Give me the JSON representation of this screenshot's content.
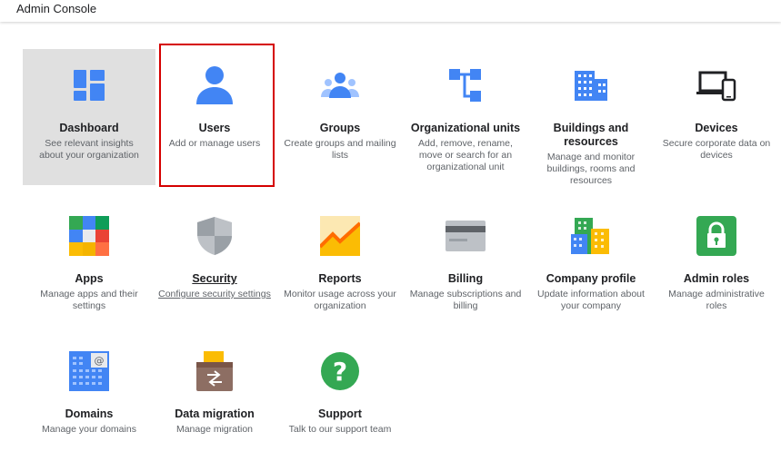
{
  "header": {
    "title": "Admin Console"
  },
  "tiles": [
    {
      "title": "Dashboard",
      "desc": "See relevant insights about your organization",
      "icon": "dashboard-icon"
    },
    {
      "title": "Users",
      "desc": "Add or manage users",
      "icon": "user-icon"
    },
    {
      "title": "Groups",
      "desc": "Create groups and mailing lists",
      "icon": "groups-icon"
    },
    {
      "title": "Organizational units",
      "desc": "Add, remove, rename, move or search for an organizational unit",
      "icon": "org-units-icon"
    },
    {
      "title": "Buildings and resources",
      "desc": "Manage and monitor buildings, rooms and resources",
      "icon": "building-icon"
    },
    {
      "title": "Devices",
      "desc": "Secure corporate data on devices",
      "icon": "devices-icon"
    },
    {
      "title": "Apps",
      "desc": "Manage apps and their settings",
      "icon": "apps-icon"
    },
    {
      "title": "Security",
      "desc": "Configure security settings",
      "icon": "shield-icon"
    },
    {
      "title": "Reports",
      "desc": "Monitor usage across your organization",
      "icon": "reports-icon"
    },
    {
      "title": "Billing",
      "desc": "Manage subscriptions and billing",
      "icon": "credit-card-icon"
    },
    {
      "title": "Company profile",
      "desc": "Update information about your company",
      "icon": "company-icon"
    },
    {
      "title": "Admin roles",
      "desc": "Manage administrative roles",
      "icon": "lock-icon"
    },
    {
      "title": "Domains",
      "desc": "Manage your domains",
      "icon": "domains-icon"
    },
    {
      "title": "Data migration",
      "desc": "Manage migration",
      "icon": "data-migration-icon"
    },
    {
      "title": "Support",
      "desc": "Talk to our support team",
      "icon": "help-icon"
    }
  ],
  "selected_tile": "Dashboard",
  "highlighted_tile": "Users",
  "colors": {
    "accent": "#4285f4",
    "highlight_border": "#d50000",
    "selected_bg": "#e0e0e0"
  }
}
